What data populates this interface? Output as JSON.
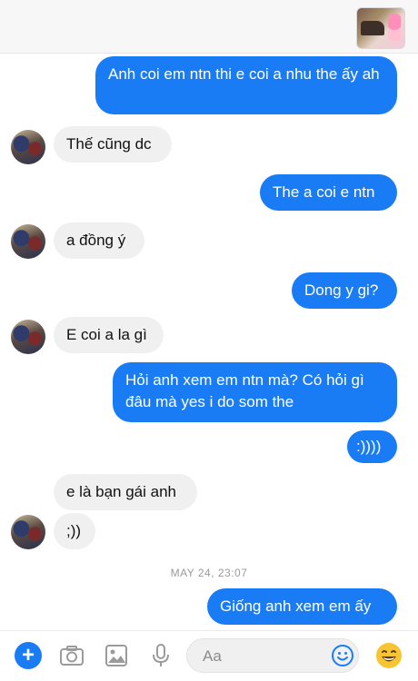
{
  "messages": [
    {
      "dir": "out",
      "text": "Anh coi em ntn thi e coi a nhu the ấy ah"
    },
    {
      "dir": "in",
      "text": "Thế cũng dc"
    },
    {
      "dir": "out",
      "text": "The a coi e ntn"
    },
    {
      "dir": "in",
      "text": "a đồng ý"
    },
    {
      "dir": "out",
      "text": "Dong y gi?"
    },
    {
      "dir": "in",
      "text": "E coi a la gì"
    },
    {
      "dir": "out",
      "text": "Hỏi anh xem em ntn mà? Có hỏi gì đâu mà yes i do som the"
    },
    {
      "dir": "out",
      "text": ":))))"
    },
    {
      "dir": "in",
      "text": "e là bạn gái anh"
    },
    {
      "dir": "in",
      "text": ";))"
    },
    {
      "dir": "out",
      "text": "Giống anh xem em ấy"
    }
  ],
  "timestamp": "MAY 24, 23:07",
  "composer": {
    "placeholder": "Aa"
  },
  "colors": {
    "outgoing_bubble": "#1a7cf5",
    "incoming_bubble": "#f1f0f0",
    "accent": "#1a7cf5"
  },
  "icons": [
    "plus-icon",
    "camera-icon",
    "photo-icon",
    "microphone-icon",
    "emoji-icon",
    "like-emoji-icon"
  ]
}
